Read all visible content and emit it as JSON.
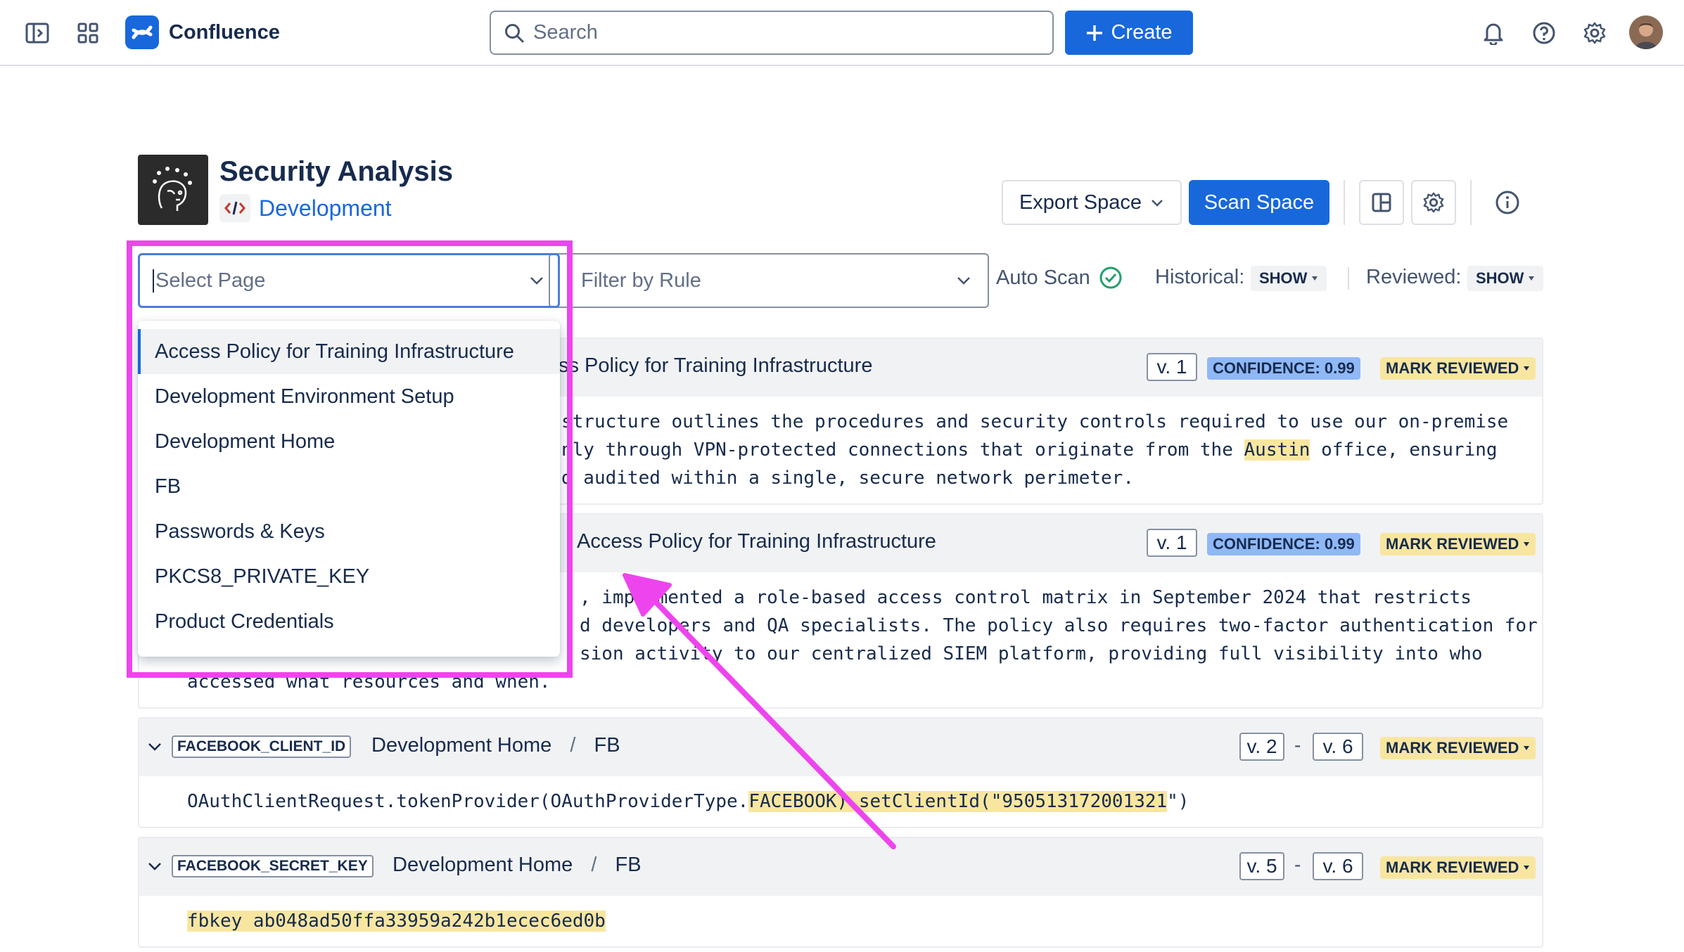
{
  "topnav": {
    "app_name": "Confluence",
    "search_placeholder": "Search",
    "create_label": "Create"
  },
  "space": {
    "title": "Security Analysis",
    "subtitle": "Development",
    "export_label": "Export Space",
    "scan_label": "Scan Space"
  },
  "filters": {
    "select_page_placeholder": "Select Page",
    "filter_rule_placeholder": "Filter by Rule",
    "auto_scan_label": "Auto Scan",
    "historical_label": "Historical:",
    "historical_value": "SHOW",
    "reviewed_label": "Reviewed:",
    "reviewed_value": "SHOW"
  },
  "dropdown": {
    "items": [
      "Access Policy for Training Infrastructure",
      "Development Environment Setup",
      "Development Home",
      "FB",
      "Passwords & Keys",
      "PKCS8_PRIVATE_KEY",
      "Product Credentials"
    ]
  },
  "findings": [
    {
      "title_visible": "ss Policy for Training Infrastructure",
      "version": "v. 1",
      "confidence": "CONFIDENCE: 0.99",
      "mark_reviewed": "MARK REVIEWED",
      "lines": [
        "structure outlines the procedures and security controls required to use our on-premise",
        [
          "nly through VPN-protected connections that originate from the ",
          "Austin",
          " office, ensuring"
        ],
        "d audited within a single, secure network perimeter."
      ]
    },
    {
      "title_visible": "Access Policy for Training Infrastructure",
      "version": "v. 1",
      "confidence": "CONFIDENCE: 0.99",
      "mark_reviewed": "MARK REVIEWED",
      "lines": [
        ", implemented a role-based access control matrix in September 2024 that restricts",
        "d developers and QA specialists. The policy also requires two-factor authentication for",
        "sion activity to our centralized SIEM platform, providing full visibility into who",
        "accessed what resources and when."
      ]
    },
    {
      "rule": "FACEBOOK_CLIENT_ID",
      "breadcrumb_page": "Development Home",
      "breadcrumb_sep": "/",
      "breadcrumb_child": "FB",
      "version_from": "v. 2",
      "version_dash": "-",
      "version_to": "v. 6",
      "mark_reviewed": "MARK REVIEWED",
      "code_prefix": "OAuthClientRequest.tokenProvider(OAuthProviderType.",
      "code_highlight": "FACEBOOK).setClientId(\"950513172001321",
      "code_suffix": "\")"
    },
    {
      "rule": "FACEBOOK_SECRET_KEY",
      "breadcrumb_page": "Development Home",
      "breadcrumb_sep": "/",
      "breadcrumb_child": "FB",
      "version_from": "v. 5",
      "version_dash": "-",
      "version_to": "v. 6",
      "mark_reviewed": "MARK REVIEWED",
      "code_highlight": "fbkey ab048ad50ffa33959a242b1ecec6ed0b"
    }
  ],
  "colors": {
    "brand_blue": "#1868db",
    "annotation_magenta": "#ee44ee",
    "highlight_yellow": "#f8e6a0",
    "confidence_blue": "#8fb8f6",
    "success_green": "#22a06b"
  },
  "icons": [
    "sidebar-toggle-icon",
    "app-switcher-icon",
    "confluence-logo-icon",
    "search-icon",
    "plus-icon",
    "bell-icon",
    "help-icon",
    "settings-icon",
    "chevron-down-icon",
    "code-icon",
    "layout-icon",
    "info-icon",
    "check-circle-icon"
  ]
}
